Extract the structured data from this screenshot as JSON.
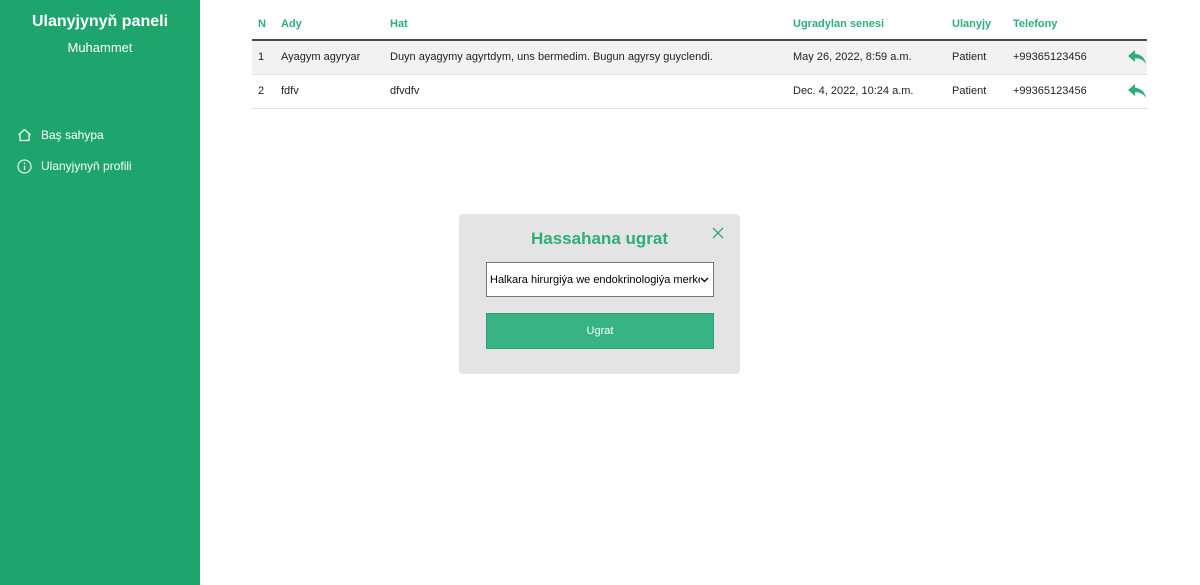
{
  "sidebar": {
    "title": "Ulanyjynyň paneli",
    "user": "Muhammet",
    "items": [
      {
        "label": "Baş sahypa",
        "icon": "home-icon"
      },
      {
        "label": "Ulanyjynyň profili",
        "icon": "info-icon"
      }
    ]
  },
  "table": {
    "headers": [
      "N",
      "Ady",
      "Hat",
      "Ugradylan senesi",
      "Ulanyjy",
      "Telefony"
    ],
    "rows": [
      {
        "n": "1",
        "ady": "Ayagym agyryar",
        "hat": "Duyn ayagymy agyrtdym, uns bermedim. Bugun agyrsy guyclendi.",
        "senesi": "May 26, 2022, 8:59 a.m.",
        "ulanyjy": "Patient",
        "telefony": "+99365123456",
        "action_icon": "reply-icon"
      },
      {
        "n": "2",
        "ady": "fdfv",
        "hat": "dfvdfv",
        "senesi": "Dec. 4, 2022, 10:24 a.m.",
        "ulanyjy": "Patient",
        "telefony": "+99365123456",
        "action_icon": "reply-icon"
      }
    ]
  },
  "modal": {
    "title": "Hassahana ugrat",
    "close_icon": "close-icon",
    "select_value": "Halkara hirurgiýa we endokrinologiýa merkezi",
    "submit_label": "Ugrat"
  },
  "colors": {
    "sidebar_bg": "#1ea56b",
    "accent": "#2eae78",
    "button_bg": "#38b384",
    "modal_bg": "#e4e4e4"
  }
}
